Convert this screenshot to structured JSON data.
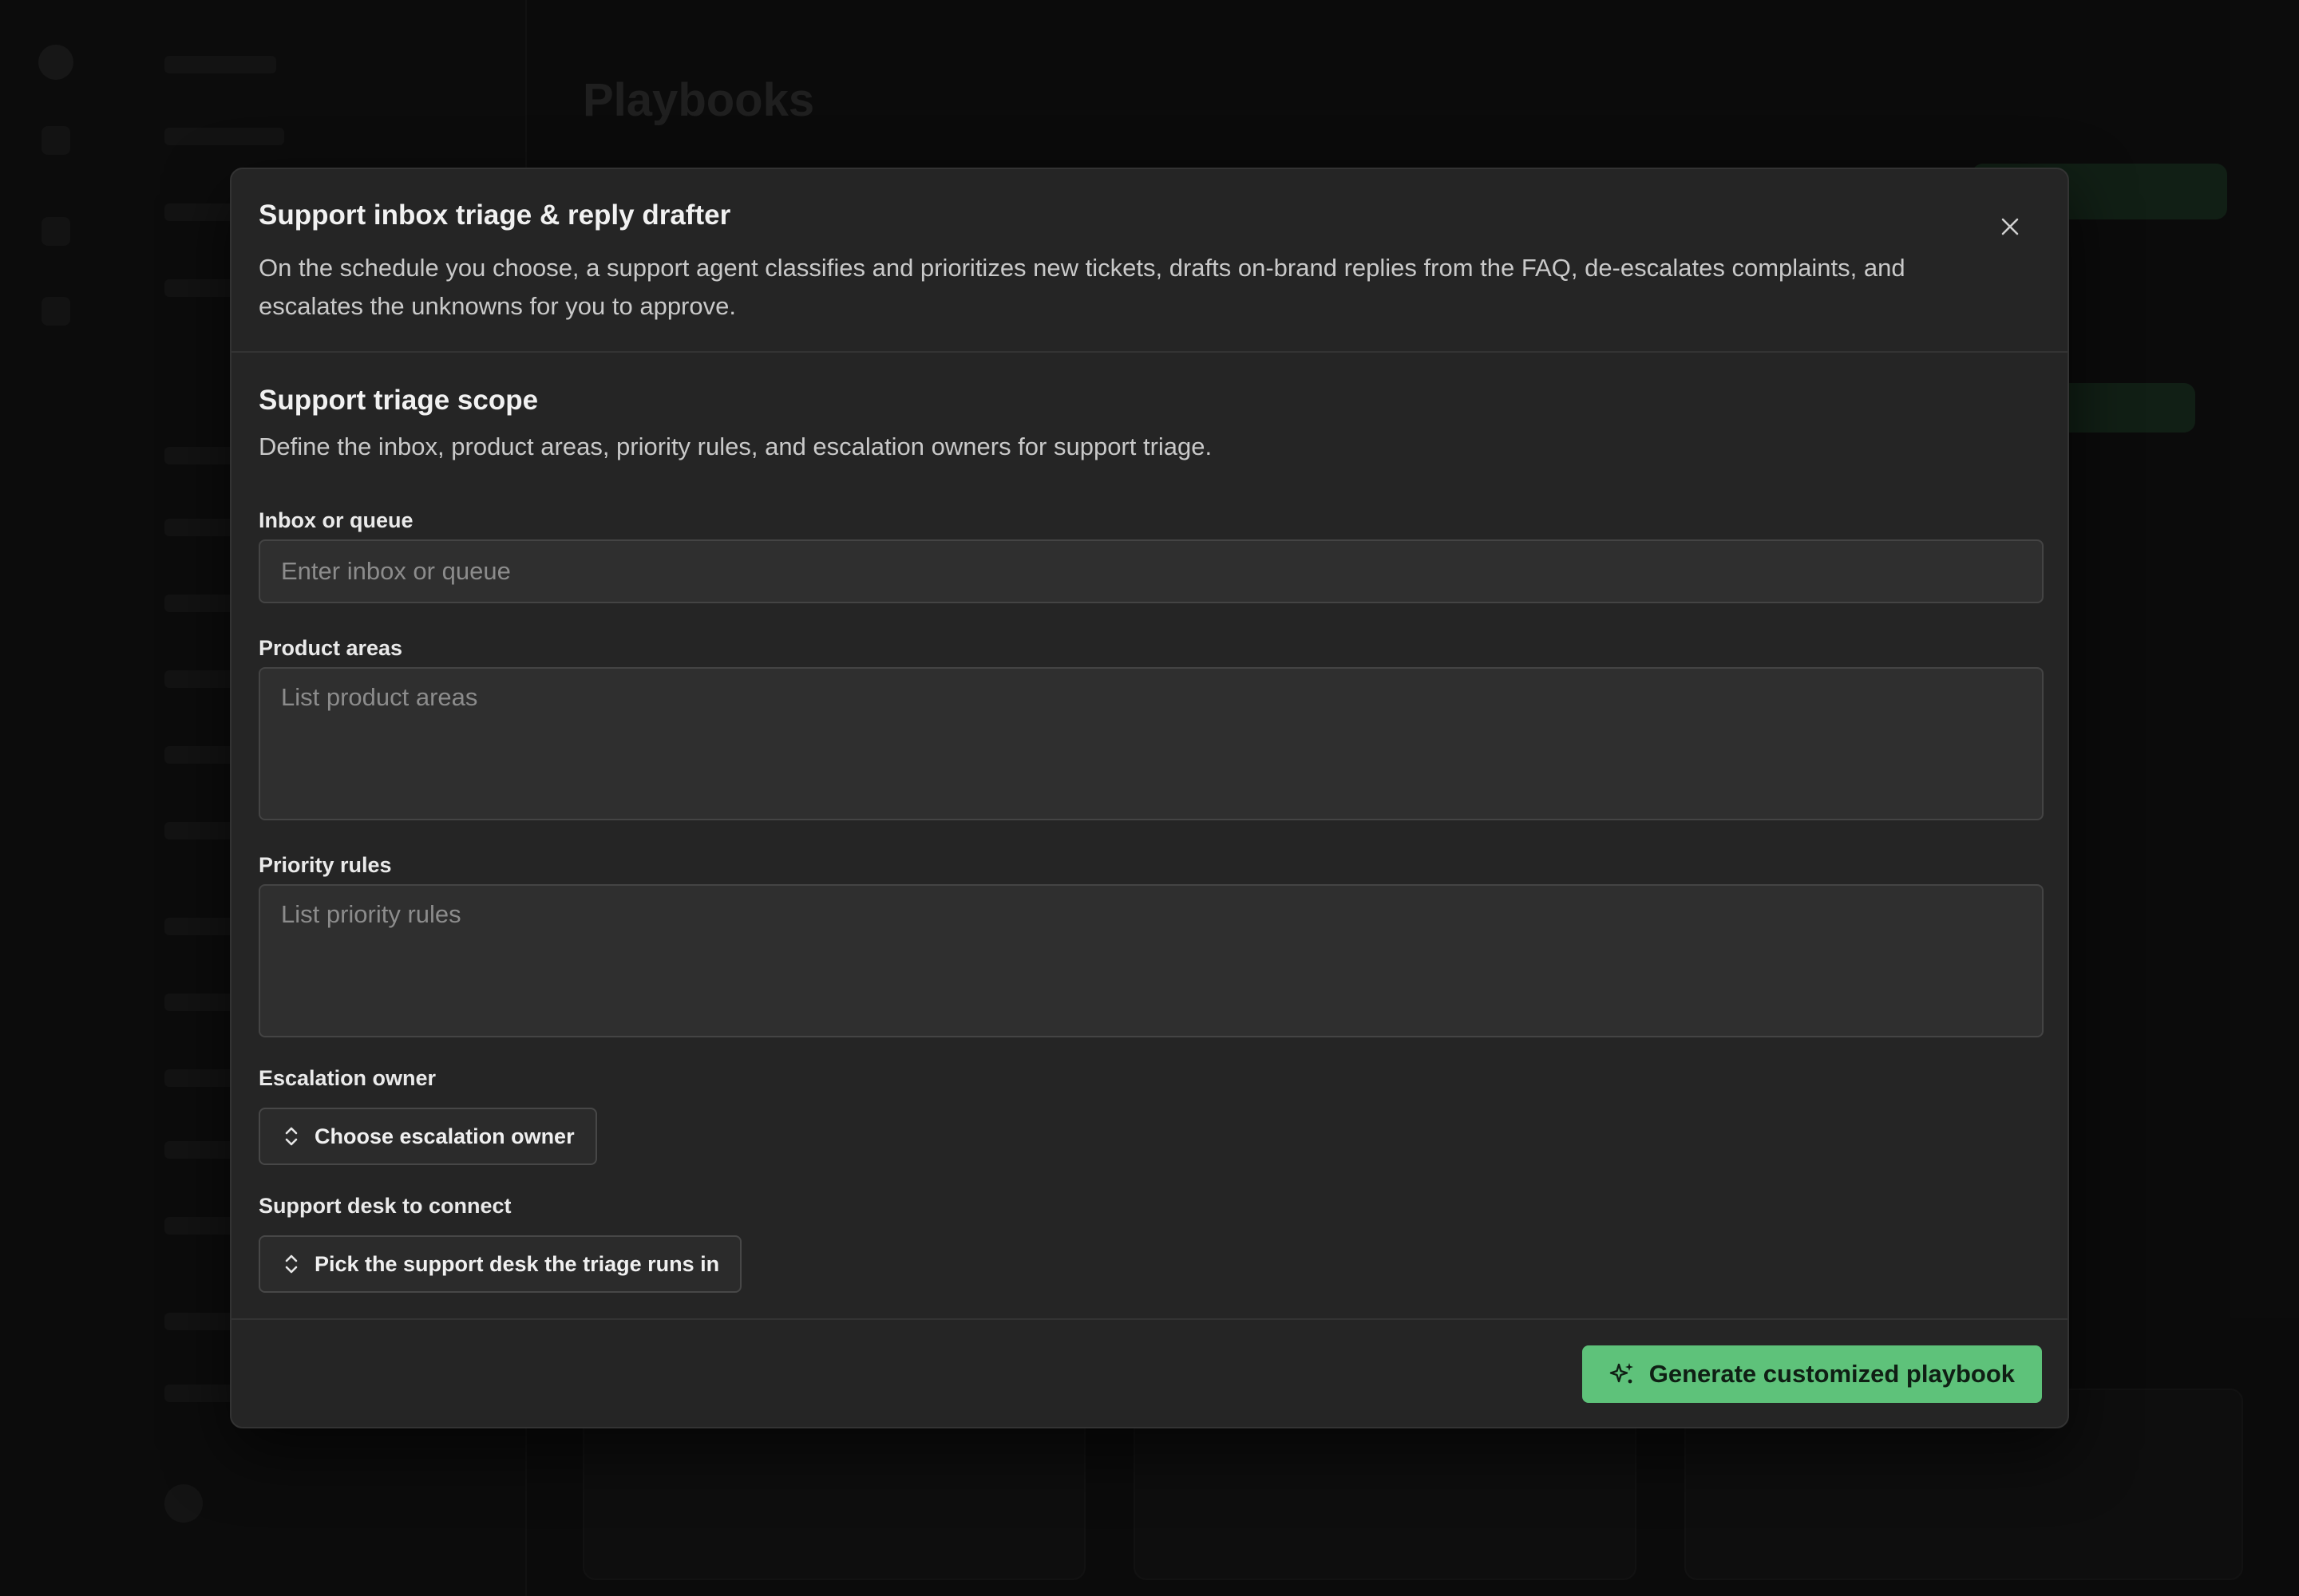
{
  "background": {
    "page_title": "Playbooks"
  },
  "modal": {
    "title": "Support inbox triage & reply drafter",
    "description": "On the schedule you choose, a support agent classifies and prioritizes new tickets, drafts on-brand replies from the FAQ, de-escalates complaints, and escalates the unknowns for you to approve.",
    "close_icon": "close-icon",
    "section": {
      "title": "Support triage scope",
      "description": "Define the inbox, product areas, priority rules, and escalation owners for support triage."
    },
    "fields": {
      "inbox": {
        "label": "Inbox or queue",
        "placeholder": "Enter inbox or queue",
        "value": ""
      },
      "product_areas": {
        "label": "Product areas",
        "placeholder": "List product areas",
        "value": ""
      },
      "priority_rules": {
        "label": "Priority rules",
        "placeholder": "List priority rules",
        "value": ""
      },
      "escalation_owner": {
        "label": "Escalation owner",
        "button_label": "Choose escalation owner",
        "icon": "chevron-up-down-icon"
      },
      "support_desk": {
        "label": "Support desk to connect",
        "button_label": "Pick the support desk the triage runs in",
        "icon": "chevron-up-down-icon"
      }
    },
    "footer": {
      "generate_label": "Generate customized playbook",
      "generate_icon": "sparkles-icon"
    }
  },
  "colors": {
    "accent": "#5ec27a",
    "modal_bg": "#252525",
    "input_bg": "#2f2f2f",
    "backdrop": "#111111"
  }
}
